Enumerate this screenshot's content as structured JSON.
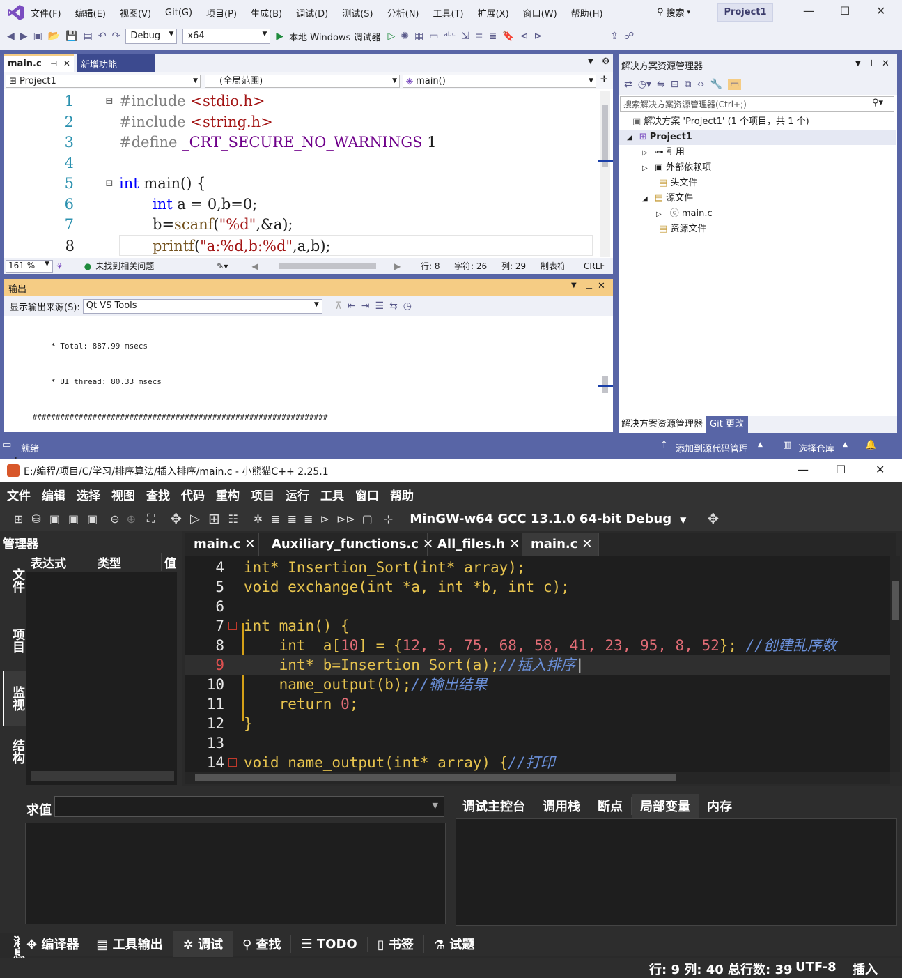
{
  "vs": {
    "menu": [
      "文件(F)",
      "编辑(E)",
      "视图(V)",
      "Git(G)",
      "项目(P)",
      "生成(B)",
      "调试(D)",
      "测试(S)",
      "分析(N)",
      "工具(T)",
      "扩展(X)",
      "窗口(W)",
      "帮助(H)"
    ],
    "search": "搜索",
    "project_badge": "Project1",
    "toolbar": {
      "config": "Debug",
      "platform": "x64",
      "run": "本地 Windows 调试器"
    },
    "editor_tabs": {
      "active": "main.c",
      "other": "新增功能"
    },
    "scope": {
      "project": "Project1",
      "range": "(全局范围)",
      "member": "main()"
    },
    "code_lines": [
      {
        "n": "1",
        "html_key": "l1"
      },
      {
        "n": "2",
        "html_key": "l2"
      }
    ],
    "code": {
      "l1_a": "#include ",
      "l1_b": "<stdio.h>",
      "l2_a": "#include ",
      "l2_b": "<string.h>",
      "l3_a": "#define ",
      "l3_b": "_CRT_SECURE_NO_WARNINGS ",
      "l3_c": "1",
      "l5_a": "int ",
      "l5_b": "main() {",
      "l6_a": "int ",
      "l6_b": "a = 0,b=0;",
      "l7_a": "b=",
      "l7_b": "scanf",
      "l7_c": "(",
      "l7_d": "\"%d\"",
      "l7_e": ",&a);",
      "l8_a": "printf",
      "l8_b": "(",
      "l8_c": "\"a:%d,b:%d\"",
      "l8_d": ",a,b);"
    },
    "line_numbers": [
      "1",
      "2",
      "3",
      "4",
      "5",
      "6",
      "7",
      "8"
    ],
    "edstatus": {
      "zoom": "161 %",
      "issues": "未找到相关问题",
      "row": "行: 8",
      "char": "字符: 26",
      "col": "列: 29",
      "tab": "制表符",
      "eol": "CRLF"
    },
    "output": {
      "title": "输出",
      "source_label": "显示输出来源(S):",
      "source_value": "Qt VS Tools",
      "lines": [
        "        * Total: 887.99 msecs",
        "        * UI thread: 80.33 msecs",
        "    ################################################################"
      ]
    },
    "solution": {
      "title": "解决方案资源管理器",
      "search_placeholder": "搜索解决方案资源管理器(Ctrl+;)",
      "root": "解决方案 'Project1' (1 个项目，共 1 个)",
      "project": "Project1",
      "items": [
        "引用",
        "外部依赖项",
        "头文件",
        "源文件",
        "main.c",
        "资源文件"
      ],
      "tabs": [
        "解决方案资源管理器",
        "Git 更改"
      ]
    },
    "status": {
      "ready": "就绪",
      "add_source": "添加到源代码管理",
      "select_repo": "选择仓库"
    }
  },
  "dev": {
    "title": "E:/编程/项目/C/学习/排序算法/插入排序/main.c - 小熊猫C++ 2.25.1",
    "menu": [
      "文件",
      "编辑",
      "选择",
      "视图",
      "查找",
      "代码",
      "重构",
      "项目",
      "运行",
      "工具",
      "窗口",
      "帮助"
    ],
    "compiler": "MinGW-w64 GCC 13.1.0 64-bit Debug",
    "manager": "管理器",
    "watch_cols": [
      "表达式",
      "类型",
      "值"
    ],
    "side_tabs": [
      "文件",
      "项目",
      "监视",
      "结构"
    ],
    "tabs": [
      "main.c",
      "Auxiliary_functions.c",
      "All_files.h",
      "main.c"
    ],
    "line_numbers": [
      "4",
      "5",
      "6",
      "7",
      "8",
      "9",
      "10",
      "11",
      "12",
      "13",
      "14"
    ],
    "code": {
      "c4": "int* Insertion_Sort(int* array);",
      "c5": "void exchange(int *a, int *b, int c);",
      "c7": "int main() {",
      "c8_a": "    int  a[",
      "c8_b": "10",
      "c8_c": "] = {",
      "c8_d": "12, 5, 75, 68, 58, 41, 23, 95, 8, 52",
      "c8_e": "}; ",
      "c8_f": "//创建乱序数",
      "c9_a": "    int* b=Insertion_Sort(a);",
      "c9_b": "//插入排序",
      "c10_a": "    name_output(b);",
      "c10_b": "//输出结果",
      "c11_a": "    return ",
      "c11_b": "0",
      "c12": "}",
      "c14_a": "void name_output(int* array) {",
      "c14_b": "//打印"
    },
    "eval_label": "求值",
    "debug_tabs": [
      "调试主控台",
      "调用栈",
      "断点",
      "局部变量",
      "内存"
    ],
    "bottom_tabs": [
      "编译器",
      "工具输出",
      "调试",
      "查找",
      "TODO",
      "书签",
      "试题"
    ],
    "msg_label": "消息",
    "status": {
      "pos": "行: 9 列: 40 总行数: 39",
      "encoding": "UTF-8",
      "mode": "插入"
    }
  }
}
